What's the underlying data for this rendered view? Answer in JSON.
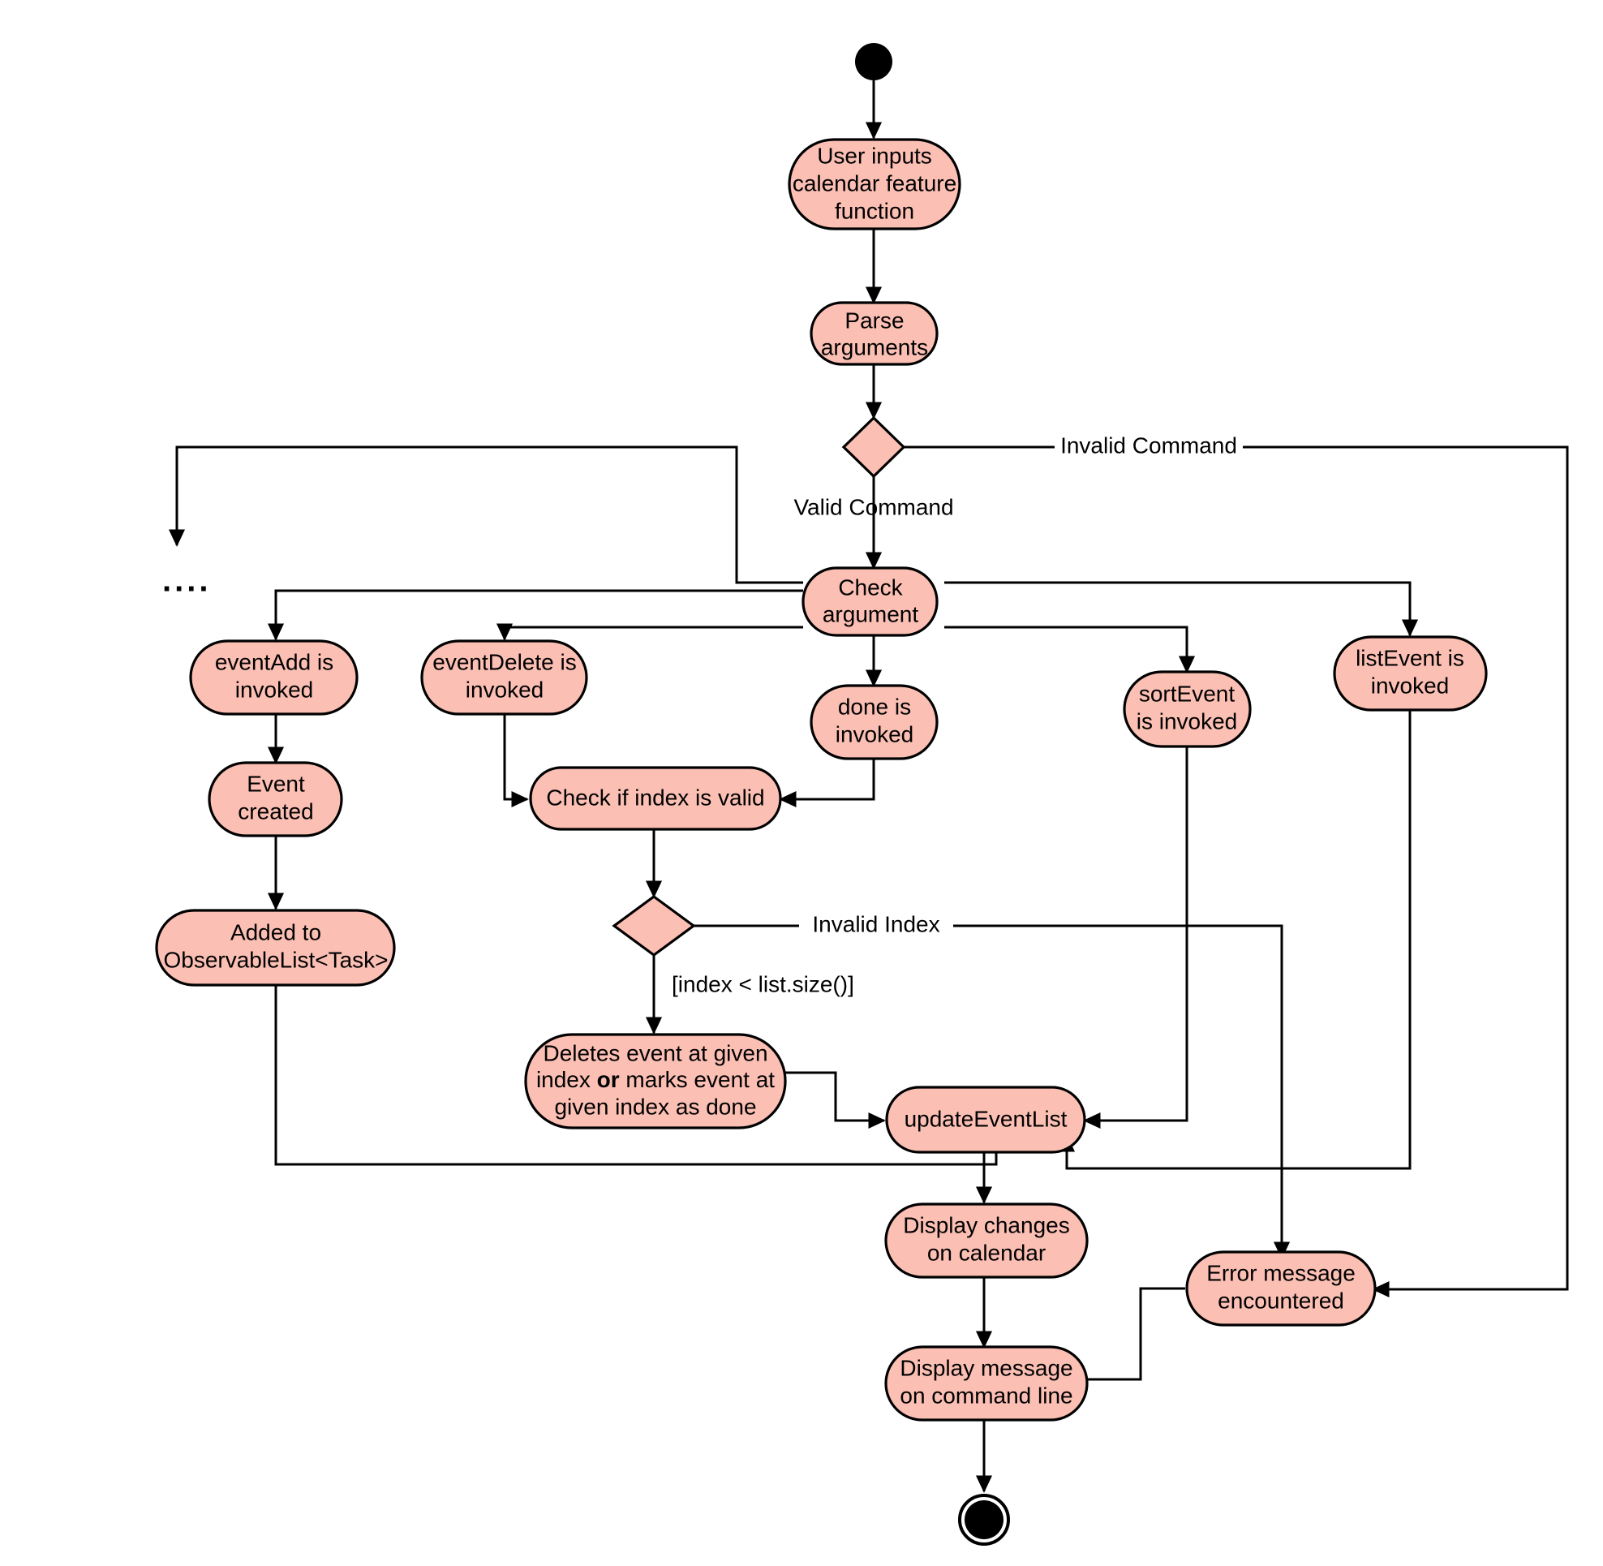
{
  "diagram": {
    "title": "Calendar feature activity diagram",
    "type": "uml-activity-diagram",
    "colors": {
      "node_fill": "#FBBFB4",
      "node_stroke": "#000000",
      "edge": "#000000",
      "background": "#FFFFFF",
      "terminal": "#000000"
    }
  },
  "nodes": {
    "start": {
      "kind": "initial-node",
      "label": ""
    },
    "user_inputs": {
      "kind": "action",
      "lines": [
        "User inputs",
        "calendar feature",
        "function"
      ]
    },
    "parse_arguments": {
      "kind": "action",
      "lines": [
        "Parse",
        "arguments"
      ]
    },
    "command_decision": {
      "kind": "decision",
      "label": ""
    },
    "check_argument": {
      "kind": "action",
      "lines": [
        "Check",
        "argument"
      ]
    },
    "event_add": {
      "kind": "action",
      "lines": [
        "eventAdd is",
        "invoked"
      ]
    },
    "event_delete": {
      "kind": "action",
      "lines": [
        "eventDelete is",
        "invoked"
      ]
    },
    "done_invoked": {
      "kind": "action",
      "lines": [
        "done is",
        "invoked"
      ]
    },
    "sort_event": {
      "kind": "action",
      "lines": [
        "sortEvent",
        "is invoked"
      ]
    },
    "list_event": {
      "kind": "action",
      "lines": [
        "listEvent is",
        "invoked"
      ]
    },
    "event_created": {
      "kind": "action",
      "lines": [
        "Event",
        "created"
      ]
    },
    "added_observable": {
      "kind": "action",
      "lines": [
        "Added to",
        "ObservableList<Task>"
      ]
    },
    "check_index": {
      "kind": "action",
      "lines": [
        "Check if index is valid"
      ]
    },
    "index_decision": {
      "kind": "decision",
      "label": ""
    },
    "deletes_event": {
      "kind": "action",
      "lines": [
        "Deletes event at given",
        "index or marks event at",
        "given index as done"
      ],
      "rich_lines": [
        [
          {
            "text": "Deletes event at given",
            "bold": false
          }
        ],
        [
          {
            "text": "index ",
            "bold": false
          },
          {
            "text": "or",
            "bold": true
          },
          {
            "text": " marks event at",
            "bold": false
          }
        ],
        [
          {
            "text": "given index as done",
            "bold": false
          }
        ]
      ]
    },
    "update_event_list": {
      "kind": "action",
      "lines": [
        "updateEventList"
      ]
    },
    "display_changes": {
      "kind": "action",
      "lines": [
        "Display changes",
        "on calendar"
      ]
    },
    "error_message": {
      "kind": "action",
      "lines": [
        "Error message",
        "encountered"
      ]
    },
    "display_message": {
      "kind": "action",
      "lines": [
        "Display message",
        "on command line"
      ]
    },
    "end": {
      "kind": "final-node",
      "label": ""
    }
  },
  "edge_labels": {
    "invalid_command": "Invalid Command",
    "valid_command": "Valid Command",
    "invalid_index": "Invalid Index",
    "index_guard": "[index < list.size()]",
    "more_branches": "...."
  },
  "flows": [
    {
      "from": "start",
      "to": "user_inputs",
      "label": ""
    },
    {
      "from": "user_inputs",
      "to": "parse_arguments",
      "label": ""
    },
    {
      "from": "parse_arguments",
      "to": "command_decision",
      "label": ""
    },
    {
      "from": "command_decision",
      "to": "error_message",
      "label": "Invalid Command"
    },
    {
      "from": "command_decision",
      "to": "check_argument",
      "label": "Valid Command"
    },
    {
      "from": "check_argument",
      "to": "more_branches",
      "label": "...."
    },
    {
      "from": "check_argument",
      "to": "event_add",
      "label": ""
    },
    {
      "from": "check_argument",
      "to": "event_delete",
      "label": ""
    },
    {
      "from": "check_argument",
      "to": "done_invoked",
      "label": ""
    },
    {
      "from": "check_argument",
      "to": "sort_event",
      "label": ""
    },
    {
      "from": "check_argument",
      "to": "list_event",
      "label": ""
    },
    {
      "from": "event_add",
      "to": "event_created",
      "label": ""
    },
    {
      "from": "event_created",
      "to": "added_observable",
      "label": ""
    },
    {
      "from": "added_observable",
      "to": "update_event_list",
      "label": ""
    },
    {
      "from": "event_delete",
      "to": "check_index",
      "label": ""
    },
    {
      "from": "done_invoked",
      "to": "check_index",
      "label": ""
    },
    {
      "from": "check_index",
      "to": "index_decision",
      "label": ""
    },
    {
      "from": "index_decision",
      "to": "error_message",
      "label": "Invalid Index"
    },
    {
      "from": "index_decision",
      "to": "deletes_event",
      "label": "[index < list.size()]"
    },
    {
      "from": "deletes_event",
      "to": "update_event_list",
      "label": ""
    },
    {
      "from": "sort_event",
      "to": "update_event_list",
      "label": ""
    },
    {
      "from": "list_event",
      "to": "update_event_list",
      "label": ""
    },
    {
      "from": "update_event_list",
      "to": "display_changes",
      "label": ""
    },
    {
      "from": "display_changes",
      "to": "display_message",
      "label": ""
    },
    {
      "from": "error_message",
      "to": "display_message",
      "label": ""
    },
    {
      "from": "display_message",
      "to": "end",
      "label": ""
    }
  ]
}
